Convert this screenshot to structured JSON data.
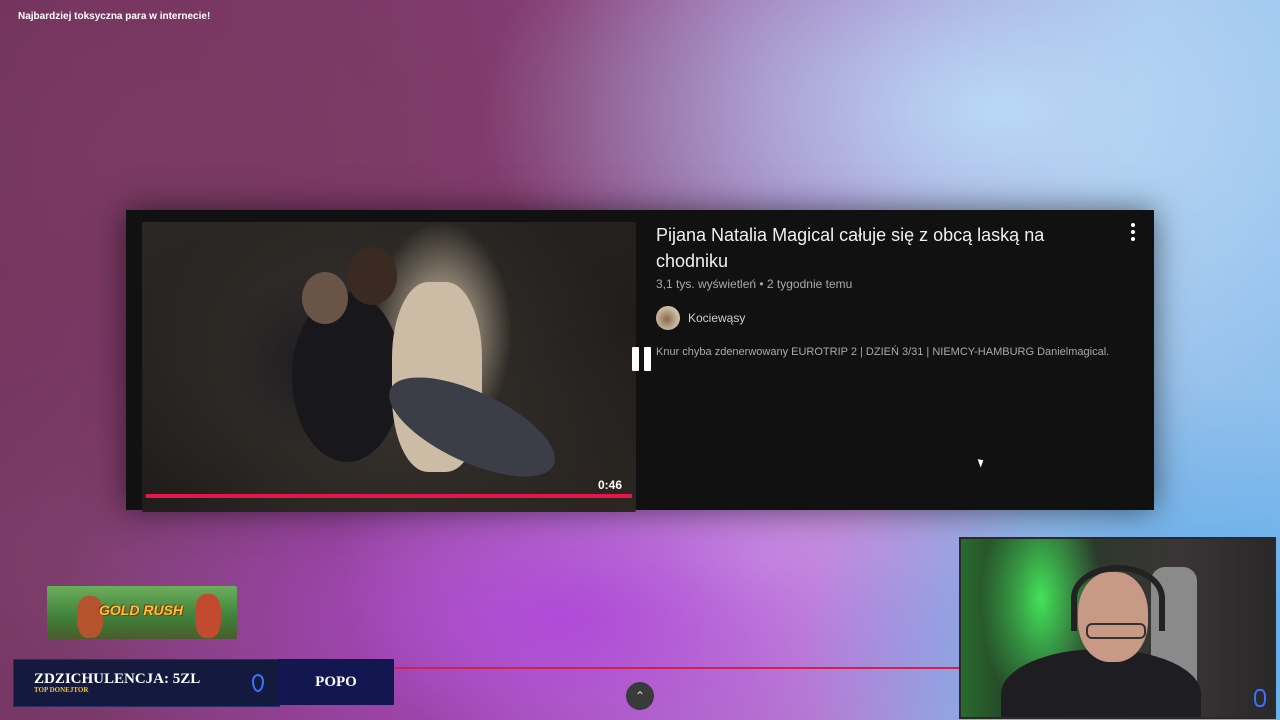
{
  "stream": {
    "top_title": "Najbardziej toksyczna para w internecie!"
  },
  "video_card": {
    "title": "Pijana Natalia Magical całuje się z obcą laską na chodniku",
    "meta": "3,1 tys. wyświetleń • 2 tygodnie temu",
    "channel_name": "Kociewąsy",
    "description": "Knur chyba zdenerwowany EUROTRIP 2 | DZIEŃ 3/31 | NIEMCY-HAMBURG Danielmagical.",
    "duration": "0:46",
    "progress_fraction": 1.0,
    "accent_color": "#e8144c"
  },
  "banner": {
    "text": "GOLD RUSH"
  },
  "donor_bar": {
    "main": "ZDZICHULENCJA: 5ZL",
    "sub": "TOP DONEJTOR",
    "right": "POPO"
  },
  "icons": {
    "more": "more-vert-icon",
    "pause": "pause-icon",
    "scroll_up": "chevron-up-icon"
  }
}
